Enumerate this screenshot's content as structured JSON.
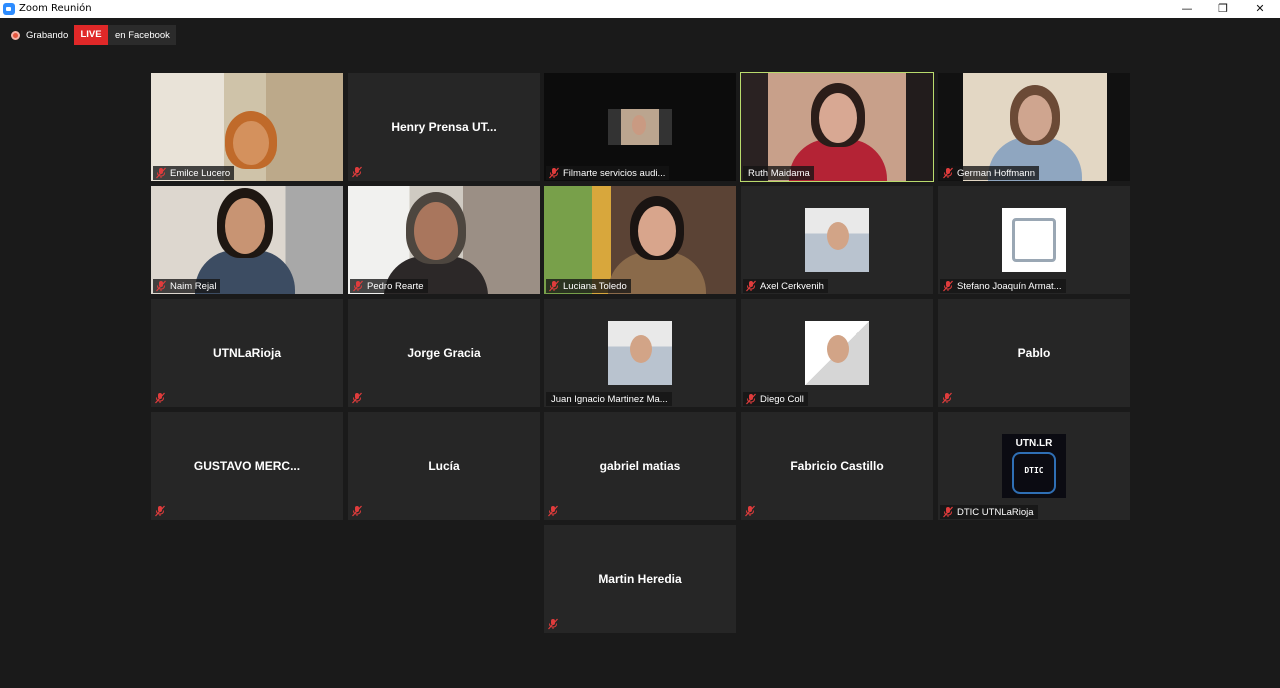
{
  "window": {
    "title": "Zoom Reunión",
    "minimize_glyph": "—",
    "maximize_glyph": "❐",
    "close_glyph": "✕"
  },
  "status": {
    "recording_label": "Grabando",
    "live_badge": "LIVE",
    "live_target": "en Facebook"
  },
  "colors": {
    "background": "#1a1a1a",
    "tile": "#262626",
    "active_speaker_border": "#b9db6d",
    "live_red": "#e02828",
    "muted_icon": "#e03c3c"
  },
  "participants": [
    {
      "name": "Emilce Lucero",
      "display": "video",
      "muted": true
    },
    {
      "name": "Henry Prensa UT...",
      "display": "name",
      "muted": true
    },
    {
      "name": "Filmarte servicios audi...",
      "display": "video",
      "muted": true
    },
    {
      "name": "Ruth Maidama",
      "display": "video",
      "muted": false,
      "active_speaker": true
    },
    {
      "name": "German Hoffmann",
      "display": "video",
      "muted": true
    },
    {
      "name": "Naim Rejal",
      "display": "video",
      "muted": true
    },
    {
      "name": "Pedro Rearte",
      "display": "video",
      "muted": true
    },
    {
      "name": "Luciana Toledo",
      "display": "video",
      "muted": true
    },
    {
      "name": "Axel Cerkvenih",
      "display": "avatar",
      "muted": true
    },
    {
      "name": "Stefano Joaquín Armat...",
      "display": "avatar",
      "muted": true
    },
    {
      "name": "UTNLaRioja",
      "display": "name",
      "muted": true
    },
    {
      "name": "Jorge Gracia",
      "display": "name",
      "muted": true
    },
    {
      "name": "Juan Ignacio Martinez Ma...",
      "display": "avatar",
      "muted": false
    },
    {
      "name": "Diego Coll",
      "display": "avatar",
      "muted": true
    },
    {
      "name": "Pablo",
      "display": "name",
      "muted": true
    },
    {
      "name": "GUSTAVO  MERC...",
      "display": "name",
      "muted": true
    },
    {
      "name": "Lucía",
      "display": "name",
      "muted": true
    },
    {
      "name": "gabriel matias",
      "display": "name",
      "muted": true
    },
    {
      "name": "Fabricio Castillo",
      "display": "name",
      "muted": true
    },
    {
      "name": "DTIC UTNLaRioja",
      "display": "avatar",
      "muted": true,
      "logo_text": "UTN.LR",
      "logo_subtext": "DTIC"
    },
    {
      "name": "Martin Heredia",
      "display": "name",
      "muted": true
    }
  ]
}
